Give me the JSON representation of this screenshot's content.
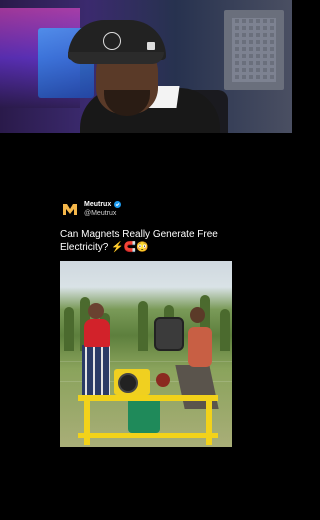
{
  "tweet": {
    "display_name": "Meutrux",
    "handle": "@Meutrux",
    "verified": true,
    "text": "Can Magnets Really Generate Free Electricity? ⚡🧲😳"
  },
  "icons": {
    "avatar": "meutrux-logo-icon",
    "verified": "verified-badge-icon"
  },
  "colors": {
    "background": "#000000",
    "verified": "#1d9bf0",
    "logo": "#f5b74a"
  }
}
